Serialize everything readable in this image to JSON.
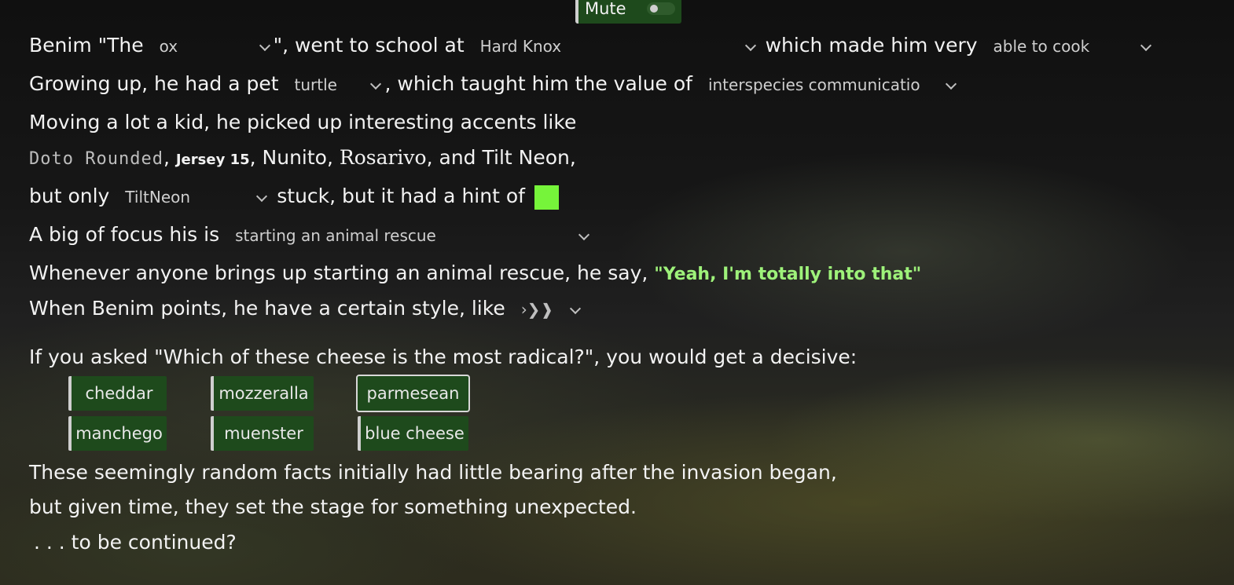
{
  "mute": {
    "label": "Mute"
  },
  "line1": {
    "pre": "Benim \"The",
    "nick": "ox",
    "mid": "\", went to school at",
    "school": "Hard Knox",
    "post": "which made him very",
    "skill": "able to cook"
  },
  "line2": {
    "pre": "Growing up, he had a pet",
    "pet": "turtle",
    "mid": ", which taught him the value of",
    "value": "interspecies communicatio"
  },
  "line3": {
    "text": "Moving a lot a kid, he picked up interesting accents like"
  },
  "line4": {
    "a1": "Doto Rounded",
    "c1": ",",
    "a2": "Jersey 15",
    "c2": ",",
    "a3": "Nunito",
    "c3": ",",
    "a4": "Rosarivo",
    "c4": ", and",
    "a5": "Tilt Neon",
    "c5": ","
  },
  "line5": {
    "pre": "but only",
    "accent": "TiltNeon",
    "post": "stuck, but it had a hint of",
    "hint_color": "#76f43a"
  },
  "line6": {
    "pre": "A big of focus his is",
    "focus": "starting an animal rescue"
  },
  "line7": {
    "pre": "Whenever anyone brings up starting an animal rescue, he say,",
    "quote": "\"Yeah, I'm totally into that\""
  },
  "line8": {
    "pre": "When Benim points, he have a certain style, like",
    "style_glyph": "›❯❱"
  },
  "line9": {
    "text": "If you asked \"Which of these cheese is the most radical?\", you would get a decisive:"
  },
  "cheeses": [
    "cheddar",
    "mozzeralla",
    "parmesean",
    "manchego",
    "muenster",
    "blue cheese"
  ],
  "selected_cheese": "parmesean",
  "outro": {
    "l1": "These seemingly random facts initially had little bearing after the invasion began,",
    "l2": "but given time, they set the stage for something unexpected.",
    "l3": ". . . to be continued?"
  }
}
